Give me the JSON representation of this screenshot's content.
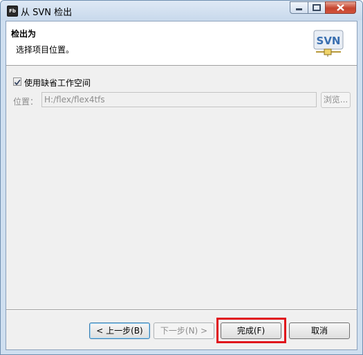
{
  "window": {
    "title": "从 SVN 检出",
    "app_icon_text": "Fb"
  },
  "banner": {
    "title": "检出为",
    "description": "选择项目位置。",
    "logo_text": "SVN"
  },
  "options": {
    "use_default_workspace_label": "使用缺省工作空间",
    "use_default_workspace_checked": true
  },
  "location": {
    "label": "位置：",
    "value": "H:/flex/flex4tfs",
    "browse_label": "浏览..."
  },
  "buttons": {
    "back": "< 上一步(B)",
    "next": "下一步(N) >",
    "finish": "完成(F)",
    "cancel": "取消"
  },
  "colors": {
    "highlight": "#e0121b",
    "title_close": "#c5452f",
    "logo": "#3a6fb0"
  }
}
